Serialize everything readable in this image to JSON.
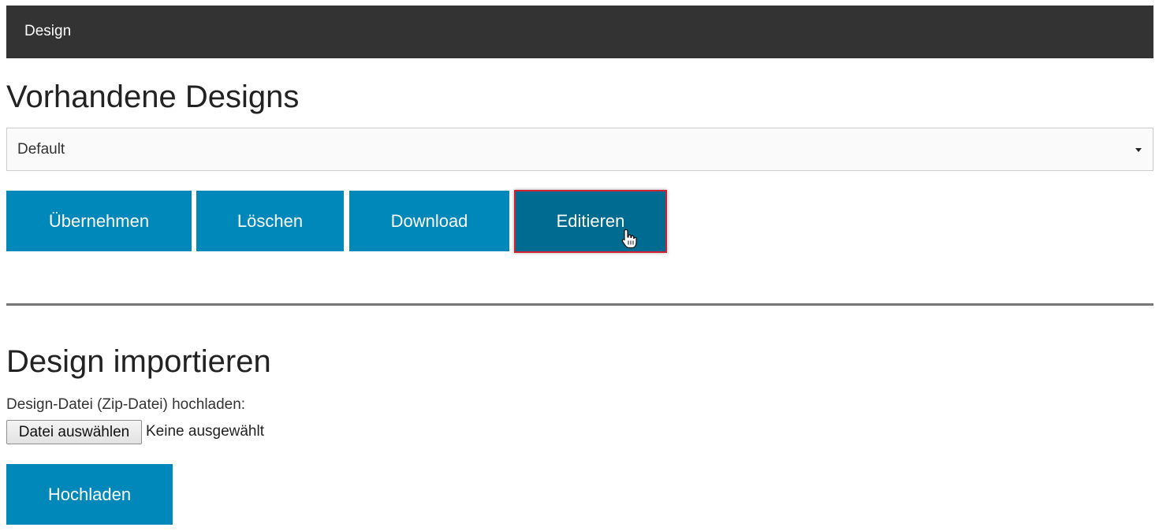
{
  "header": {
    "title": "Design"
  },
  "existing_designs": {
    "heading": "Vorhandene Designs",
    "select": {
      "selected": "Default"
    },
    "buttons": {
      "apply": "Übernehmen",
      "delete": "Löschen",
      "download": "Download",
      "edit": "Editieren"
    }
  },
  "import": {
    "heading": "Design importieren",
    "upload_label": "Design-Datei (Zip-Datei) hochladen:",
    "file_button": "Datei auswählen",
    "file_status": "Keine ausgewählt",
    "upload_button": "Hochladen"
  },
  "colors": {
    "header_bg": "#333333",
    "button_bg": "#0088bb",
    "button_active_bg": "#006b91",
    "highlight_border": "#cc2233"
  },
  "icons": {
    "select_arrow": "caret-down-icon",
    "cursor": "hand-pointer-icon"
  }
}
